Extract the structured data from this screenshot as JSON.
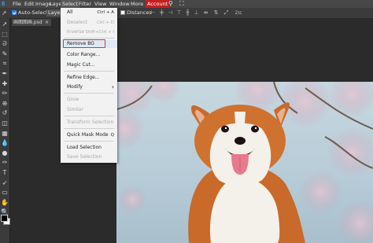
{
  "menubar": {
    "items": [
      "File",
      "Edit",
      "Image",
      "Layer",
      "Select",
      "Filter",
      "View",
      "Window",
      "More"
    ],
    "account": "Account",
    "logo_letter": "E"
  },
  "options_bar": {
    "auto_select_label": "Auto-Select",
    "auto_select_checked": true,
    "layer_dropdown": "Layer",
    "distances_label": "Distances",
    "distances_checked": false,
    "transform_label": "⤢",
    "extra_label": "2ɪᴄ"
  },
  "document": {
    "tab_name": "画图图画.psd",
    "tab_close": "×"
  },
  "select_menu": {
    "items": [
      {
        "label": "All",
        "shortcut": "Ctrl + A",
        "disabled": false
      },
      {
        "label": "Deselect",
        "shortcut": "Ctrl + D",
        "disabled": true
      },
      {
        "label": "Inverse",
        "shortcut": "Shift+Ctrl + I",
        "disabled": true
      },
      {
        "label": "Remove BG",
        "shortcut": "",
        "disabled": false,
        "highlighted": true
      },
      {
        "label": "Color Range...",
        "shortcut": "",
        "disabled": false
      },
      {
        "label": "Magic Cut...",
        "shortcut": "",
        "disabled": false
      },
      {
        "label": "Refine Edge...",
        "shortcut": "",
        "disabled": false
      },
      {
        "label": "Modify",
        "shortcut": "›",
        "disabled": false
      },
      {
        "label": "Grow",
        "shortcut": "",
        "disabled": true
      },
      {
        "label": "Similar",
        "shortcut": "",
        "disabled": true
      },
      {
        "label": "Transform Selection",
        "shortcut": "",
        "disabled": true
      },
      {
        "label": "Quick Mask Mode",
        "shortcut": "Q",
        "disabled": false
      },
      {
        "label": "Load Selection",
        "shortcut": "",
        "disabled": false
      },
      {
        "label": "Save Selection",
        "shortcut": "",
        "disabled": true
      }
    ]
  },
  "toolbar": {
    "tools": [
      "move-tool",
      "marquee-tool",
      "lasso-tool",
      "quick-select-tool",
      "crop-tool",
      "eyedropper-tool",
      "healing-tool",
      "brush-tool",
      "stamp-tool",
      "history-brush-tool",
      "eraser-tool",
      "gradient-tool",
      "blur-tool",
      "dodge-tool",
      "pen-tool",
      "type-tool",
      "path-select-tool",
      "shape-tool",
      "hand-tool",
      "zoom-tool"
    ],
    "glyphs": [
      "➚",
      "⬚",
      "ᘐ",
      "✎",
      "⌗",
      "✒",
      "✚",
      "✏",
      "⊕",
      "↺",
      "◫",
      "▦",
      "💧",
      "●",
      "✑",
      "T",
      "➶",
      "▭",
      "✋",
      "🔍"
    ]
  },
  "colors": {
    "menubar_bg": "#474747",
    "account_bg": "#c41f1f",
    "highlight_border": "#d8343a",
    "checkbox_blue": "#2f7de1",
    "menu_bg": "#f2f2f2",
    "fur_orange": "#c96a2b",
    "fur_white": "#f4f0ea",
    "sky": "#c0d3dd",
    "blossom": "#d9b6c8"
  },
  "photo": {
    "subject": "corgi-dog",
    "background": "cherry-blossoms"
  }
}
